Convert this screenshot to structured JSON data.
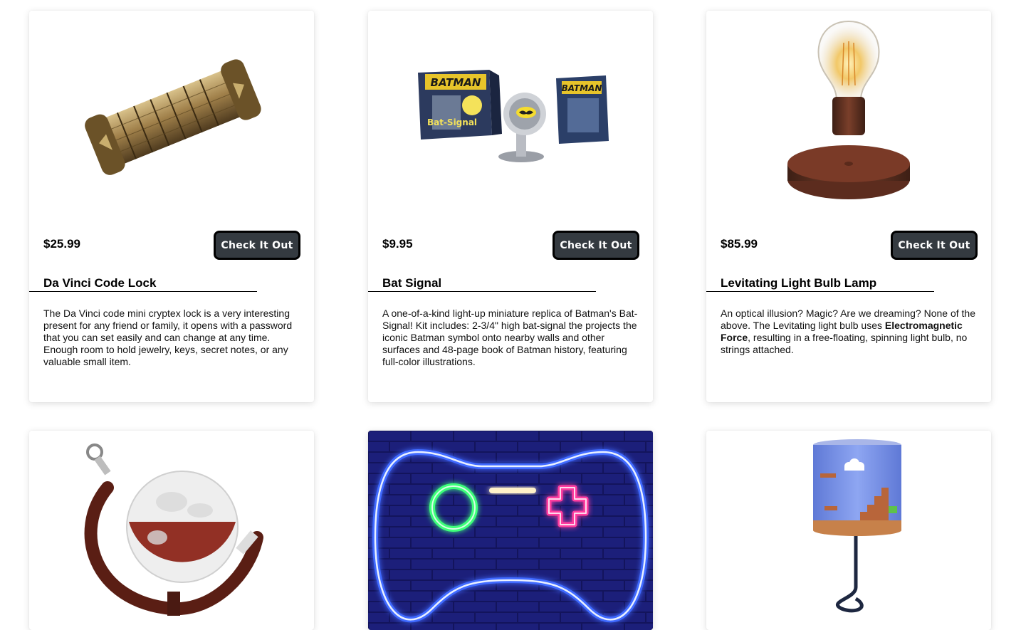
{
  "products": [
    {
      "image": "cryptex-lock-image",
      "price": "$25.99",
      "button_label": "Check It Out",
      "title": "Da Vinci Code Lock",
      "description": "The Da Vinci code mini cryptex lock is a very interesting present for any friend or family, it opens with a password that you can set easily and can change at any time. Enough room to hold jewelry, keys, secret notes, or any valuable small item."
    },
    {
      "image": "bat-signal-kit-image",
      "image_text": {
        "box_title": "BATMAN",
        "box_subtitle": "Bat-Signal",
        "book_title": "BATMAN"
      },
      "price": "$9.95",
      "button_label": "Check It Out",
      "title": "Bat Signal",
      "description": "A one-of-a-kind light-up miniature replica of Batman's Bat-Signal! Kit includes: 2-3/4\" high bat-signal the projects the iconic Batman symbol onto nearby walls and other surfaces and 48-page book of Batman history, featuring full-color illustrations."
    },
    {
      "image": "levitating-bulb-image",
      "price": "$85.99",
      "button_label": "Check It Out",
      "title": "Levitating Light Bulb Lamp",
      "description_before": "An optical illusion? Magic? Are we dreaming? None of the above. The Levitating light bulb uses ",
      "description_bold": "Electromagnetic Force",
      "description_after": ", resulting in a free-floating, spinning light bulb, no strings attached."
    },
    {
      "image": "globe-decanter-image"
    },
    {
      "image": "neon-gamepad-sign-image"
    },
    {
      "image": "mario-lamp-image"
    }
  ],
  "colors": {
    "button_bg": "#343a40",
    "button_border": "#000000",
    "neon_blue": "#2f5bff",
    "neon_green": "#3dff7a",
    "neon_pink": "#ff3ca0"
  }
}
